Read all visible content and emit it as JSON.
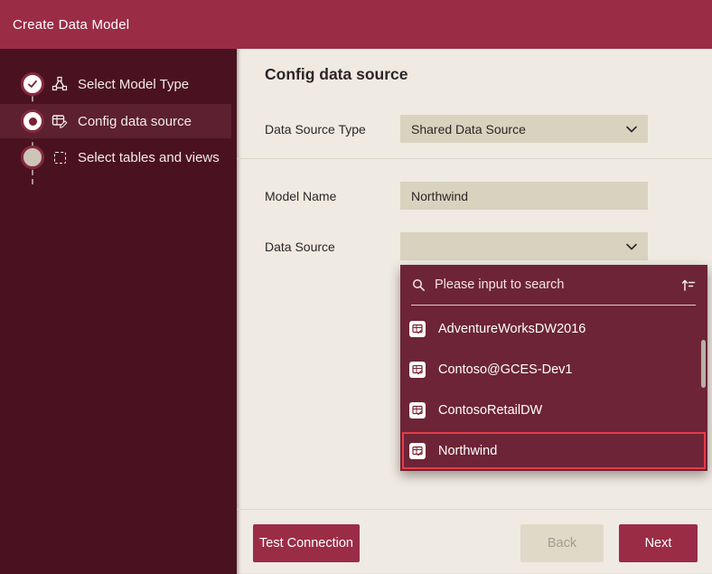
{
  "window": {
    "title": "Create Data Model"
  },
  "wizard": {
    "steps": [
      {
        "label": "Select Model Type",
        "state": "completed"
      },
      {
        "label": "Config data source",
        "state": "current"
      },
      {
        "label": "Select tables and views",
        "state": "pending"
      }
    ]
  },
  "main": {
    "heading": "Config data source",
    "fields": {
      "data_source_type": {
        "label": "Data Source Type",
        "value": "Shared Data Source"
      },
      "model_name": {
        "label": "Model Name",
        "value": "Northwind"
      },
      "data_source": {
        "label": "Data Source",
        "value": ""
      }
    }
  },
  "dropdown": {
    "search_placeholder": "Please input to search",
    "items": [
      {
        "label": "AdventureWorksDW2016",
        "selected": false
      },
      {
        "label": "Contoso@GCES-Dev1",
        "selected": false
      },
      {
        "label": "ContosoRetailDW",
        "selected": false
      },
      {
        "label": "Northwind",
        "selected": true
      }
    ]
  },
  "footer": {
    "test_connection": "Test Connection",
    "back": "Back",
    "next": "Next"
  },
  "colors": {
    "accent": "#9b2c46",
    "sidebar": "#4a1220",
    "sidebar_active": "#5c2031",
    "panel": "#6d2436",
    "field_bg": "#d8d3be",
    "main_bg": "#efebe2",
    "selected_border": "#e23d47",
    "disabled_bg": "#dfdac8",
    "disabled_text": "#a29c90"
  }
}
